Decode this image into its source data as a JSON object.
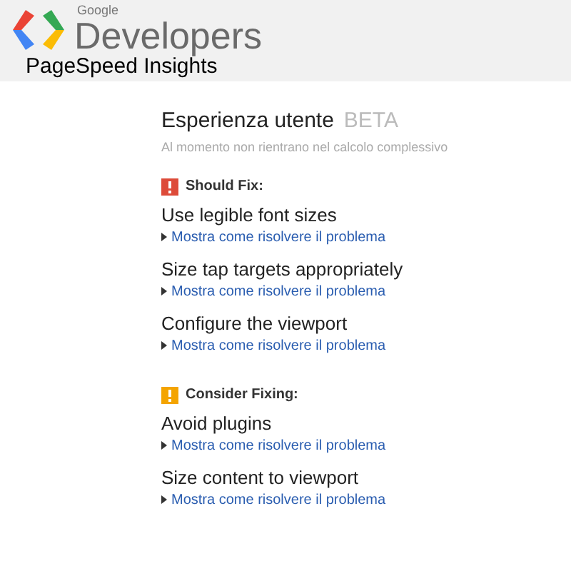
{
  "header": {
    "brand_small": "Google",
    "brand_large": "Developers",
    "product": "PageSpeed Insights"
  },
  "section": {
    "title": "Esperienza utente",
    "badge": "BETA",
    "subtitle": "Al momento non rientrano nel calcolo complessivo"
  },
  "groups": [
    {
      "kind": "should_fix",
      "heading": "Should Fix:",
      "items": [
        {
          "title": "Use legible font sizes",
          "link": "Mostra come risolvere il problema"
        },
        {
          "title": "Size tap targets appropriately",
          "link": "Mostra come risolvere il problema"
        },
        {
          "title": "Configure the viewport",
          "link": "Mostra come risolvere il problema"
        }
      ]
    },
    {
      "kind": "consider",
      "heading": "Consider Fixing:",
      "items": [
        {
          "title": "Avoid plugins",
          "link": "Mostra come risolvere il problema"
        },
        {
          "title": "Size content to viewport",
          "link": "Mostra come risolvere il problema"
        }
      ]
    }
  ]
}
